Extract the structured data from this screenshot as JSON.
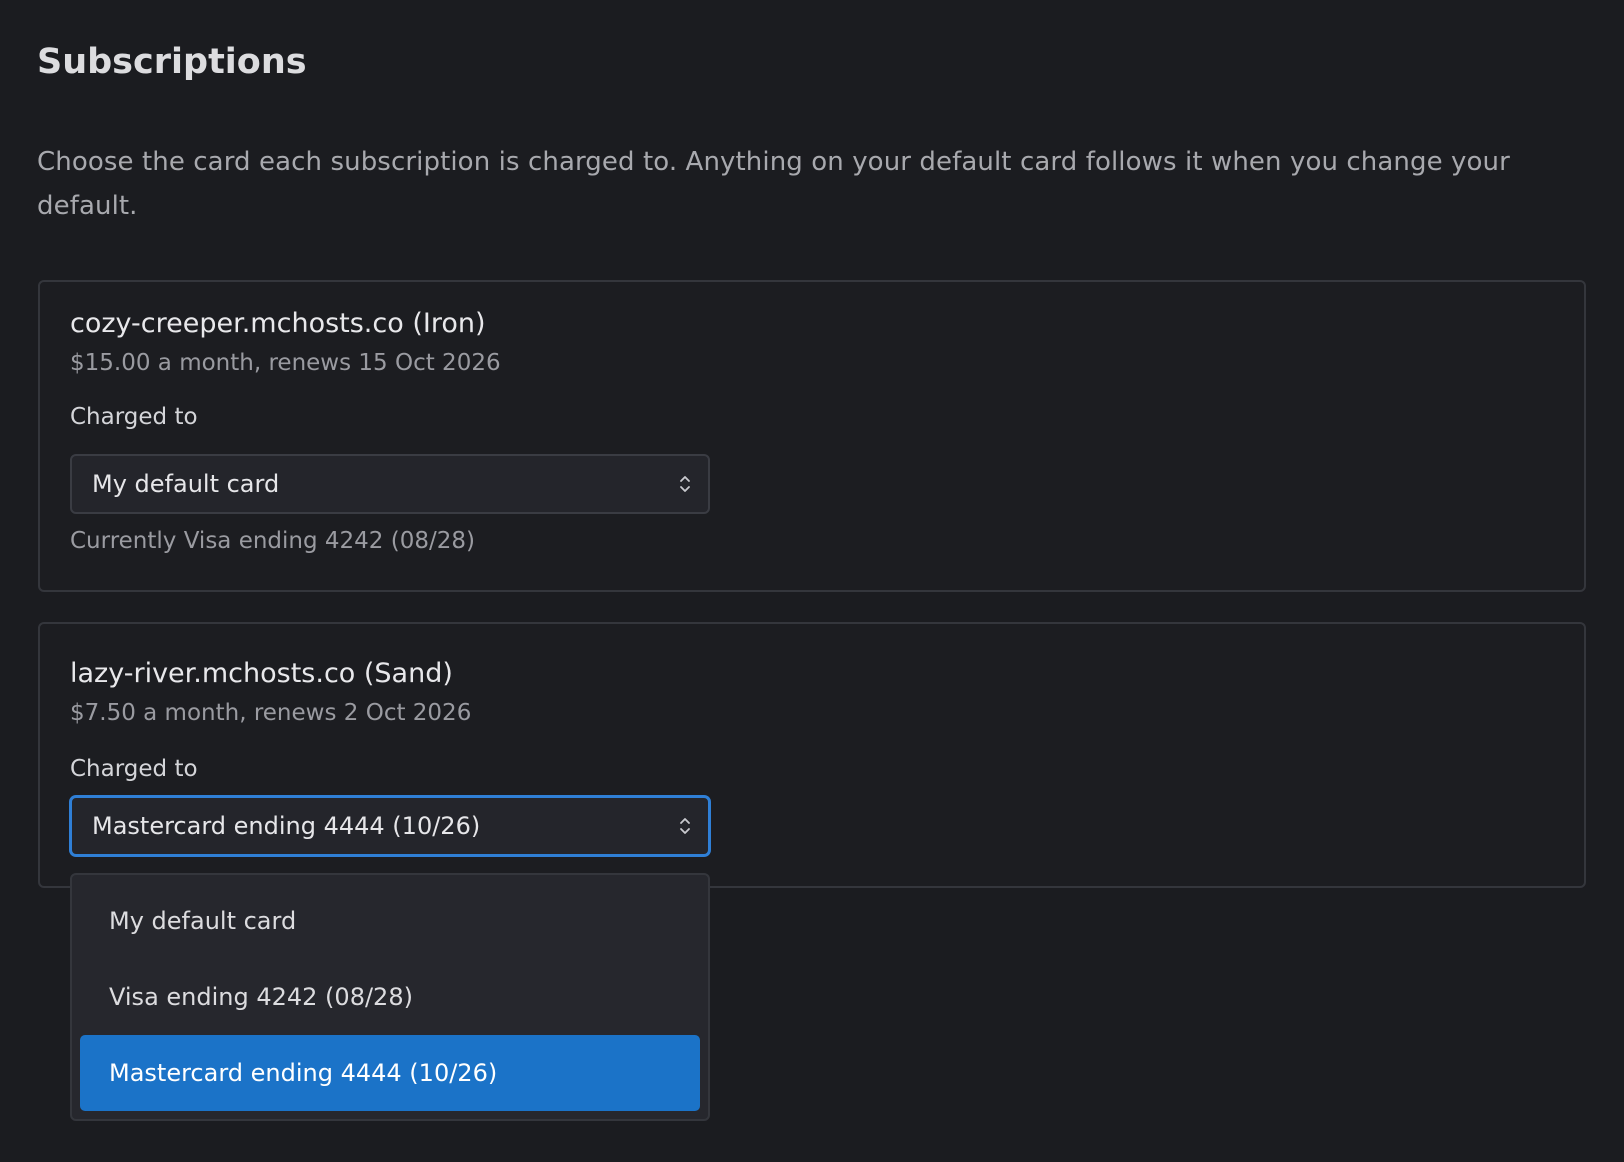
{
  "page": {
    "title": "Subscriptions",
    "intro": "Choose the card each subscription is charged to. Anything on your default card follows it when you change your default."
  },
  "subscriptions": [
    {
      "name": "cozy-creeper.mchosts.co (Iron)",
      "meta": "$15.00 a month, renews 15 Oct 2026",
      "charged_label": "Charged to",
      "selected": "My default card",
      "hint": "Currently Visa ending 4242 (08/28)"
    },
    {
      "name": "lazy-river.mchosts.co (Sand)",
      "meta": "$7.50 a month, renews 2 Oct 2026",
      "charged_label": "Charged to",
      "selected": "Mastercard ending 4444 (10/26)"
    }
  ],
  "dropdown": {
    "options": [
      "My default card",
      "Visa ending 4242 (08/28)",
      "Mastercard ending 4444 (10/26)"
    ],
    "selected_index": 2
  },
  "colors": {
    "background": "#1b1c20",
    "accent": "#1b73c8",
    "focus_border": "#2f7fd6"
  },
  "icons": {
    "select_chevron": "chevron-up-down-icon"
  }
}
